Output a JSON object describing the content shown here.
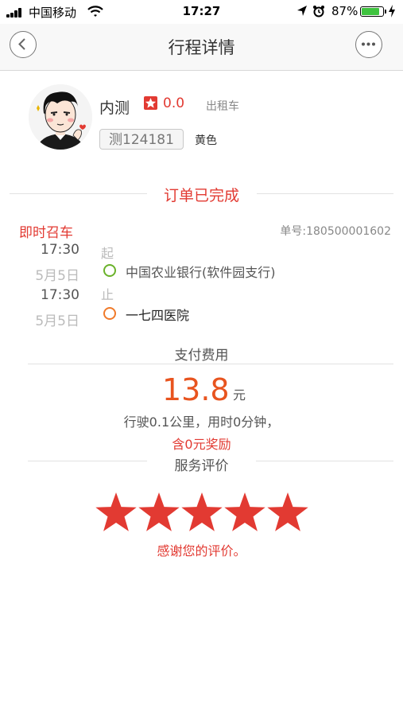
{
  "status_bar": {
    "carrier": "中国移动",
    "time": "17:27",
    "battery_percent": "87%",
    "battery_level": 0.87,
    "icons": [
      "signal-icon",
      "wifi-icon",
      "location-arrow-icon",
      "alarm-icon",
      "battery-icon",
      "charging-bolt-icon"
    ]
  },
  "nav": {
    "title": "行程详情",
    "back_icon": "chevron-left-icon",
    "more_icon": "more-dots-icon"
  },
  "driver": {
    "name": "内测",
    "rating": "0.0",
    "vehicle_type": "出租车",
    "plate": "测124181",
    "vehicle_color": "黄色"
  },
  "order": {
    "status": "订单已完成",
    "type": "即时召车",
    "number": "单号:180500001602",
    "start": {
      "time": "17:30",
      "date": "5月5日",
      "mark": "起",
      "address": "中国农业银行(软件园支行)"
    },
    "end": {
      "time": "17:30",
      "date": "5月5日",
      "mark": "止",
      "address": "一七四医院"
    }
  },
  "fee": {
    "title": "支付费用",
    "amount": "13.8",
    "unit": "元",
    "description": "行驶0.1公里，用时0分钟，",
    "bonus": "含0元奖励"
  },
  "review": {
    "title": "服务评价",
    "stars": 5,
    "thanks": "感谢您的评价。"
  },
  "colors": {
    "accent_red": "#e23a32",
    "amount_orange": "#e8541f",
    "start_dot": "#6ab22a",
    "end_dot": "#f07a2a",
    "battery_green": "#3fc33f"
  }
}
